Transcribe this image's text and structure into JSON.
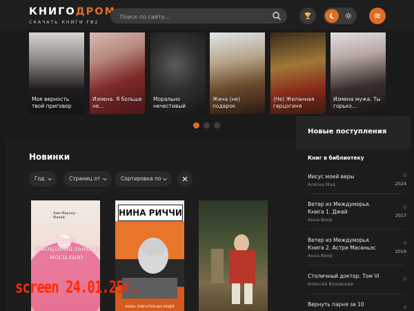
{
  "header": {
    "logo_part1": "КНИГО",
    "logo_part2": "ДРОМ",
    "logo_sub": "СКАЧАТЬ КНИГИ FB2",
    "search_placeholder": "Поиск по сайту..."
  },
  "colors": {
    "accent": "#e06d22",
    "bg": "#1a1a1a",
    "card": "#252525"
  },
  "carousel": {
    "slides": [
      {
        "caption": "Моя верность твой приговор"
      },
      {
        "caption": "Измена. Я больше не..."
      },
      {
        "caption": "Морально нечестивый"
      },
      {
        "caption": "Жена (не) подарок"
      },
      {
        "caption": "(Не) Желанная герцогиня"
      },
      {
        "caption": "Измена мужа. Ты горько..."
      }
    ],
    "active_dot": 1,
    "dot_count": 3
  },
  "main": {
    "section_title": "Новинки",
    "filters": [
      "Год",
      "Страниц от",
      "Сортировка по"
    ],
    "books": [
      {
        "cover_title": "Нет эмоциональному насилию",
        "cover_author": "Эми Марлоу-Макой"
      },
      {
        "cover_title": "НИНА РИЧЧИ",
        "cover_series": "ЖИЗНЬ ЗАМЕЧАТЕЛЬНЫХ ЛЮДЕЙ"
      },
      {
        "cover_title": ""
      }
    ]
  },
  "sidebar": {
    "title": "Новые поступления",
    "subtitle": "Книг в библиотеку",
    "items": [
      {
        "title": "Иисус моей веры",
        "author": "Аляска Мэд",
        "count": "0",
        "year": "2024"
      },
      {
        "title": "Ветер из Междуморья. Книга 1. Джай",
        "author": "Анна Виор",
        "count": "0",
        "year": "2017"
      },
      {
        "title": "Ветер из Междуморья. Книга 2. Астри Масаньэс",
        "author": "Анна Виор",
        "count": "0",
        "year": "2019"
      },
      {
        "title": "Столичный доктор. Том VI",
        "author": "Алексей Вязовский",
        "count": "0",
        "year": ""
      },
      {
        "title": "Вернуть парня за 10",
        "author": "",
        "count": "0",
        "year": ""
      }
    ]
  },
  "stamp": "screen 24.01.25г."
}
